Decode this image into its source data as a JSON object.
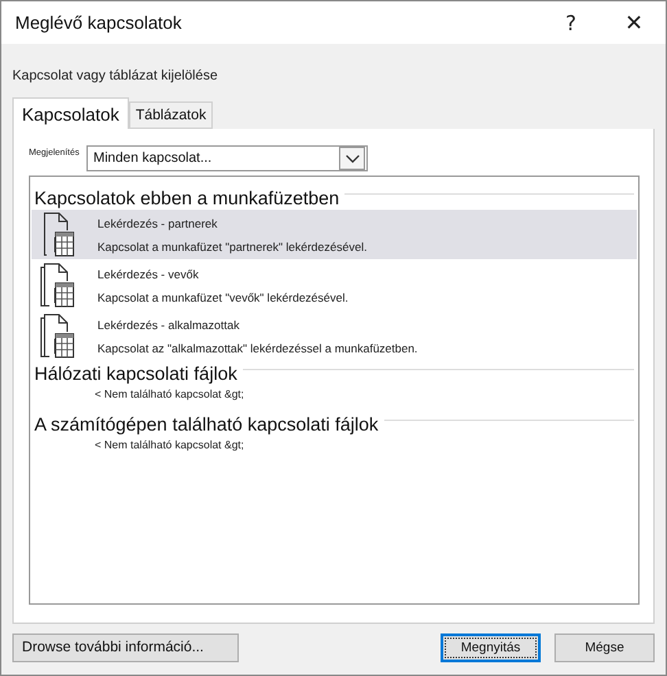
{
  "window": {
    "title": "Meglévő kapcsolatok",
    "help": "?",
    "close": "✕"
  },
  "instruction": "Kapcsolat vagy táblázat kijelölése",
  "tabs": [
    {
      "label": "Kapcsolatok",
      "selected": true
    },
    {
      "label": "Táblázatok",
      "selected": false
    }
  ],
  "show": {
    "label": "Megjelenítés",
    "value": "Minden kapcsolat..."
  },
  "sections": [
    {
      "heading": "Kapcsolatok ebben a munkafüzetben",
      "items": [
        {
          "name": "Lekérdezés - partnerek",
          "description": "Kapcsolat a munkafüzet \"partnerek\" lekérdezésével.",
          "kind": "single",
          "selected": true
        },
        {
          "name": "Lekérdezés - vevők",
          "description": "Kapcsolat a munkafüzet \"vevők\" lekérdezésével.",
          "kind": "multi",
          "selected": false
        },
        {
          "name": "Lekérdezés - alkalmazottak",
          "description": "Kapcsolat az \"alkalmazottak\" lekérdezéssel a munkafüzetben.",
          "kind": "multi",
          "selected": false
        }
      ]
    },
    {
      "heading": "Hálózati kapcsolati fájlok",
      "empty": "< Nem található kapcsolat &gt;"
    },
    {
      "heading": "A számítógépen található kapcsolati fájlok",
      "empty": "< Nem található kapcsolat &gt;"
    }
  ],
  "buttons": [
    {
      "label": "Drowse további információ...",
      "kind": "browse"
    },
    {
      "label": "Megnyitás",
      "kind": "default"
    },
    {
      "label": "Mégse",
      "kind": "normal"
    }
  ]
}
